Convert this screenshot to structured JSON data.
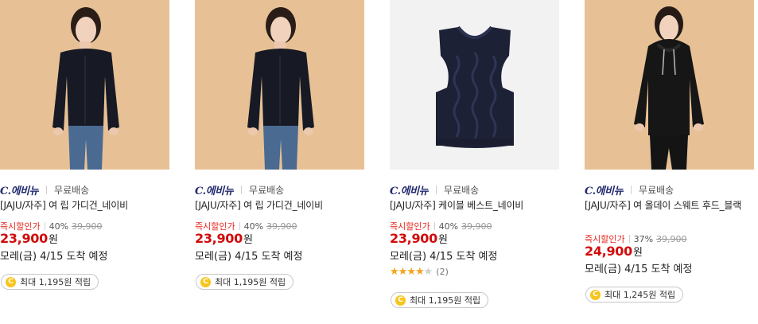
{
  "products": [
    {
      "brand": "C.에비뉴",
      "shipping": "무료배송",
      "title": "[JAJU/자주] 여 립 가디건_네이비",
      "discount_label": "즉시할인가",
      "discount_pct": "40%",
      "original_price": "39,900",
      "price": "23,900",
      "currency": "원",
      "delivery": "모레(금) 4/15 도착 예정",
      "points": "최대 1,195원 적립",
      "image_icon": "model-navy-cardigan"
    },
    {
      "brand": "C.에비뉴",
      "shipping": "무료배송",
      "title": "[JAJU/자주] 여 립 가디건_네이비",
      "discount_label": "즉시할인가",
      "discount_pct": "40%",
      "original_price": "39,900",
      "price": "23,900",
      "currency": "원",
      "delivery": "모레(금) 4/15 도착 예정",
      "points": "최대 1,195원 적립",
      "image_icon": "model-navy-cardigan"
    },
    {
      "brand": "C.에비뉴",
      "shipping": "무료배송",
      "title": "[JAJU/자주] 케이블 베스트_네이비",
      "discount_label": "즉시할인가",
      "discount_pct": "40%",
      "original_price": "39,900",
      "price": "23,900",
      "currency": "원",
      "delivery": "모레(금) 4/15 도착 예정",
      "rating": 4,
      "rating_max": 5,
      "review_count": "(2)",
      "points": "최대 1,195원 적립",
      "image_icon": "navy-cable-vest"
    },
    {
      "brand": "C.에비뉴",
      "shipping": "무료배송",
      "title": "[JAJU/자주] 여 올데이 스웨트 후드_블랙",
      "discount_label": "즉시할인가",
      "discount_pct": "37%",
      "original_price": "39,900",
      "price": "24,900",
      "currency": "원",
      "delivery": "모레(금) 4/15 도착 예정",
      "points": "최대 1,245원 적립",
      "image_icon": "model-black-hoodie"
    }
  ],
  "coin_symbol": "C",
  "star_char": "★",
  "colors": {
    "brand": "#222a6e",
    "discount_label": "#e8261d",
    "price": "#d20a0a",
    "star": "#f3a41d",
    "coin": "#f8c51c",
    "photo_bg": "#e6bf93"
  }
}
